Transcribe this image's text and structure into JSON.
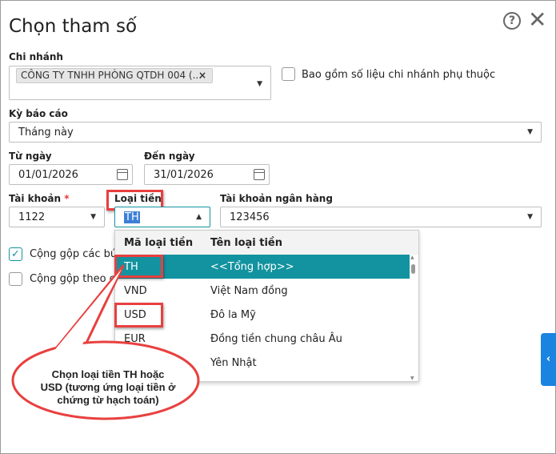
{
  "dialog": {
    "title": "Chọn tham số",
    "help_icon": "help-circle-icon",
    "close_icon": "close-icon"
  },
  "branch": {
    "label": "Chi nhánh",
    "tag": "CÔNG TY TNHH PHÒNG QTDH 004 (...",
    "tag_remove": "×",
    "include_dependent_label": "Bao gồm số liệu chi nhánh phụ thuộc",
    "include_dependent_checked": false
  },
  "period": {
    "label": "Kỳ báo cáo",
    "value": "Tháng này"
  },
  "from_date": {
    "label": "Từ ngày",
    "value": "01/01/2026"
  },
  "to_date": {
    "label": "Đến ngày",
    "value": "31/01/2026"
  },
  "account": {
    "label": "Tài khoản",
    "required": "*",
    "value": "1122"
  },
  "currency": {
    "label": "Loại tiền",
    "value": "TH"
  },
  "bank_account": {
    "label": "Tài khoản ngân hàng",
    "value": "123456"
  },
  "options": [
    {
      "label": "Cộng gộp các bút",
      "checked": true
    },
    {
      "label": "Cộng gộp theo ch",
      "checked": false
    }
  ],
  "currency_list": {
    "headers": [
      "Mã loại tiền",
      "Tên loại tiền"
    ],
    "rows": [
      {
        "code": "TH",
        "name": "<<Tổng hợp>>",
        "selected": true
      },
      {
        "code": "VND",
        "name": "Việt Nam đồng"
      },
      {
        "code": "USD",
        "name": "Đô la Mỹ"
      },
      {
        "code": "EUR",
        "name": "Đồng tiền chung châu Âu"
      },
      {
        "code": "",
        "name": "Yên Nhật"
      }
    ]
  },
  "callout": {
    "text": "Chọn loại tiền TH hoặc USD (tương ứng loại tiền ở chứng từ hạch toán)"
  },
  "colors": {
    "accent": "#12939f",
    "highlight": "#e8403f",
    "side_tab": "#1a84e0"
  }
}
